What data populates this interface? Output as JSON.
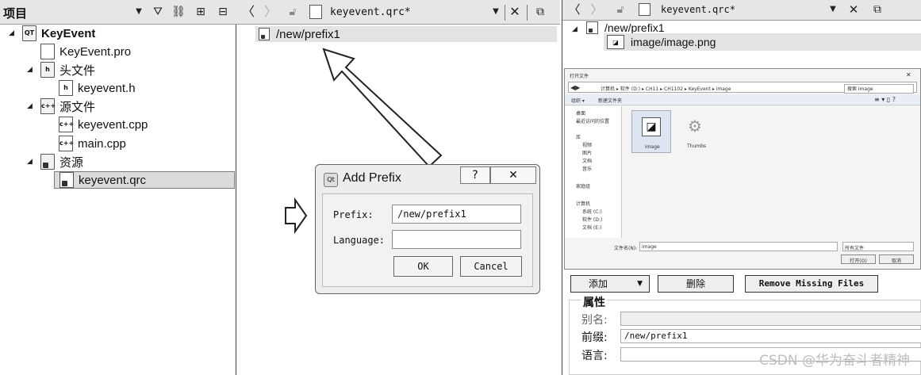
{
  "left": {
    "title": "项目",
    "tree": [
      {
        "label": "KeyEvent"
      },
      {
        "label": "KeyEvent.pro"
      },
      {
        "label": "头文件"
      },
      {
        "label": "keyevent.h"
      },
      {
        "label": "源文件"
      },
      {
        "label": "keyevent.cpp"
      },
      {
        "label": "main.cpp"
      },
      {
        "label": "资源"
      },
      {
        "label": "keyevent.qrc"
      }
    ]
  },
  "editor": {
    "tab_title": "keyevent.qrc*",
    "prefix": "/new/prefix1",
    "file": "image/image.png"
  },
  "dialog": {
    "title": "Add Prefix",
    "help_label": "?",
    "close_label": "✕",
    "prefix_label": "Prefix:",
    "prefix_value": "/new/prefix1",
    "language_label": "Language:",
    "language_value": "",
    "ok_label": "OK",
    "cancel_label": "Cancel"
  },
  "file_dialog": {
    "title": "打开文件",
    "path": "计算机 ▸ 软件 (D:) ▸ CH11 ▸ CH1102 ▸ KeyEvent ▸ image",
    "search_placeholder": "搜索 image",
    "organize_label": "组织 ▾",
    "new_folder_label": "新建文件夹",
    "sidebar": [
      "桌面",
      "最近访问的位置",
      "库",
      "视频",
      "图片",
      "文档",
      "音乐",
      "家庭组",
      "计算机",
      "系统 (C:)",
      "软件 (D:)",
      "文档 (E:)"
    ],
    "files": [
      "image",
      "Thumbs"
    ],
    "filename_label": "文件名(N):",
    "filename_value": "image",
    "filter_value": "所有文件",
    "open_label": "打开(O)",
    "cancel_label": "取消"
  },
  "actions": {
    "add_label": "添加",
    "delete_label": "删除",
    "remove_missing_label": "Remove Missing Files"
  },
  "properties": {
    "title": "属性",
    "alias_label": "别名:",
    "alias_value": "",
    "prefix_label": "前缀:",
    "prefix_value": "/new/prefix1",
    "language_label": "语言:",
    "language_value": ""
  },
  "watermark": "CSDN @华为奋斗者精神"
}
